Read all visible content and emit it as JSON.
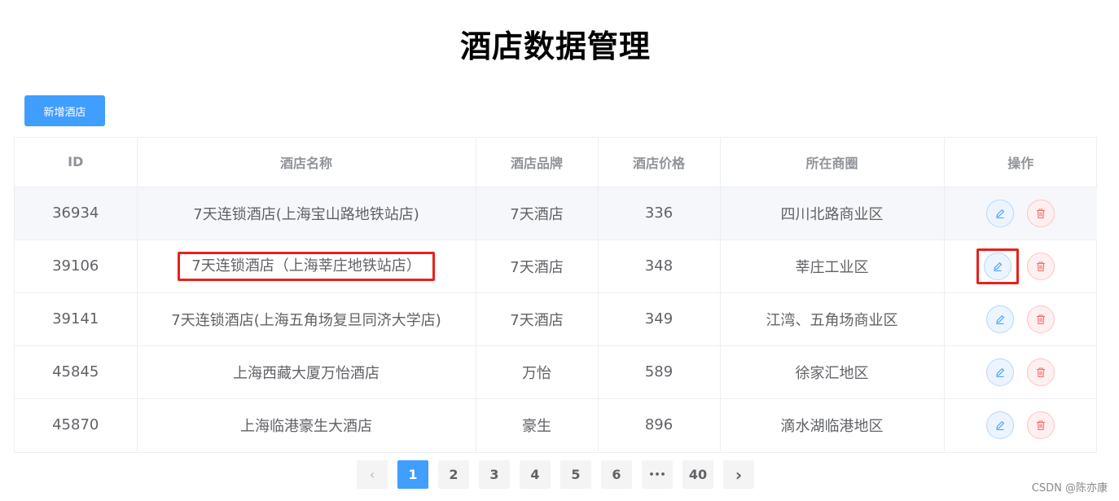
{
  "page": {
    "title": "酒店数据管理",
    "add_button_label": "新增酒店",
    "watermark": "CSDN @陈亦康"
  },
  "colors": {
    "primary": "#409eff",
    "danger": "#f56c6c",
    "highlight": "#e8211b"
  },
  "table": {
    "headers": [
      "ID",
      "酒店名称",
      "酒店品牌",
      "酒店价格",
      "所在商圈",
      "操作"
    ],
    "rows": [
      {
        "id": "36934",
        "name": "7天连锁酒店(上海宝山路地铁站店)",
        "brand": "7天酒店",
        "price": "336",
        "business": "四川北路商业区"
      },
      {
        "id": "39106",
        "name": "7天连锁酒店（上海莘庄地铁站店）",
        "brand": "7天酒店",
        "price": "348",
        "business": "莘庄工业区"
      },
      {
        "id": "39141",
        "name": "7天连锁酒店(上海五角场复旦同济大学店)",
        "brand": "7天酒店",
        "price": "349",
        "business": "江湾、五角场商业区"
      },
      {
        "id": "45845",
        "name": "上海西藏大厦万怡酒店",
        "brand": "万怡",
        "price": "589",
        "business": "徐家汇地区"
      },
      {
        "id": "45870",
        "name": "上海临港豪生大酒店",
        "brand": "豪生",
        "price": "896",
        "business": "滴水湖临港地区"
      }
    ],
    "actions": {
      "edit_icon": "edit-icon",
      "delete_icon": "trash-icon"
    }
  },
  "pagination": {
    "prev": "‹",
    "pages": [
      "1",
      "2",
      "3",
      "4",
      "5",
      "6"
    ],
    "ellipsis": "•••",
    "last": "40",
    "next": "›",
    "current": "1"
  }
}
